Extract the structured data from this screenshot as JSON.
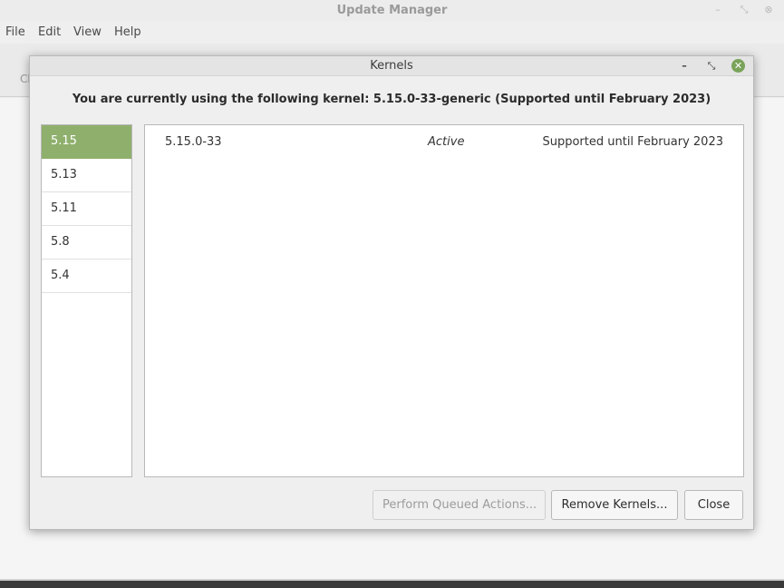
{
  "main_window": {
    "title": "Update Manager",
    "menu": [
      "File",
      "Edit",
      "View",
      "Help"
    ],
    "partial_toolbar_text": "Cl",
    "controls": {
      "minimize_glyph": "–",
      "maximize_glyph": "⤡",
      "close_glyph": "⊗"
    }
  },
  "dialog": {
    "title": "Kernels",
    "controls": {
      "minimize_glyph": "–",
      "maximize_glyph": "⤡",
      "close_glyph": "✕"
    },
    "heading": "You are currently using the following kernel: 5.15.0-33-generic (Supported until February 2023)",
    "versions": [
      {
        "label": "5.15",
        "selected": true
      },
      {
        "label": "5.13",
        "selected": false
      },
      {
        "label": "5.11",
        "selected": false
      },
      {
        "label": "5.8",
        "selected": false
      },
      {
        "label": "5.4",
        "selected": false
      }
    ],
    "kernels": [
      {
        "version": "5.15.0-33",
        "status": "Active",
        "support": "Supported until February 2023"
      }
    ],
    "buttons": {
      "perform_queued": "Perform Queued Actions...",
      "remove_kernels": "Remove Kernels...",
      "close": "Close"
    }
  },
  "colors": {
    "accent_green": "#8fb06d",
    "close_button_green": "#7aa35a"
  }
}
